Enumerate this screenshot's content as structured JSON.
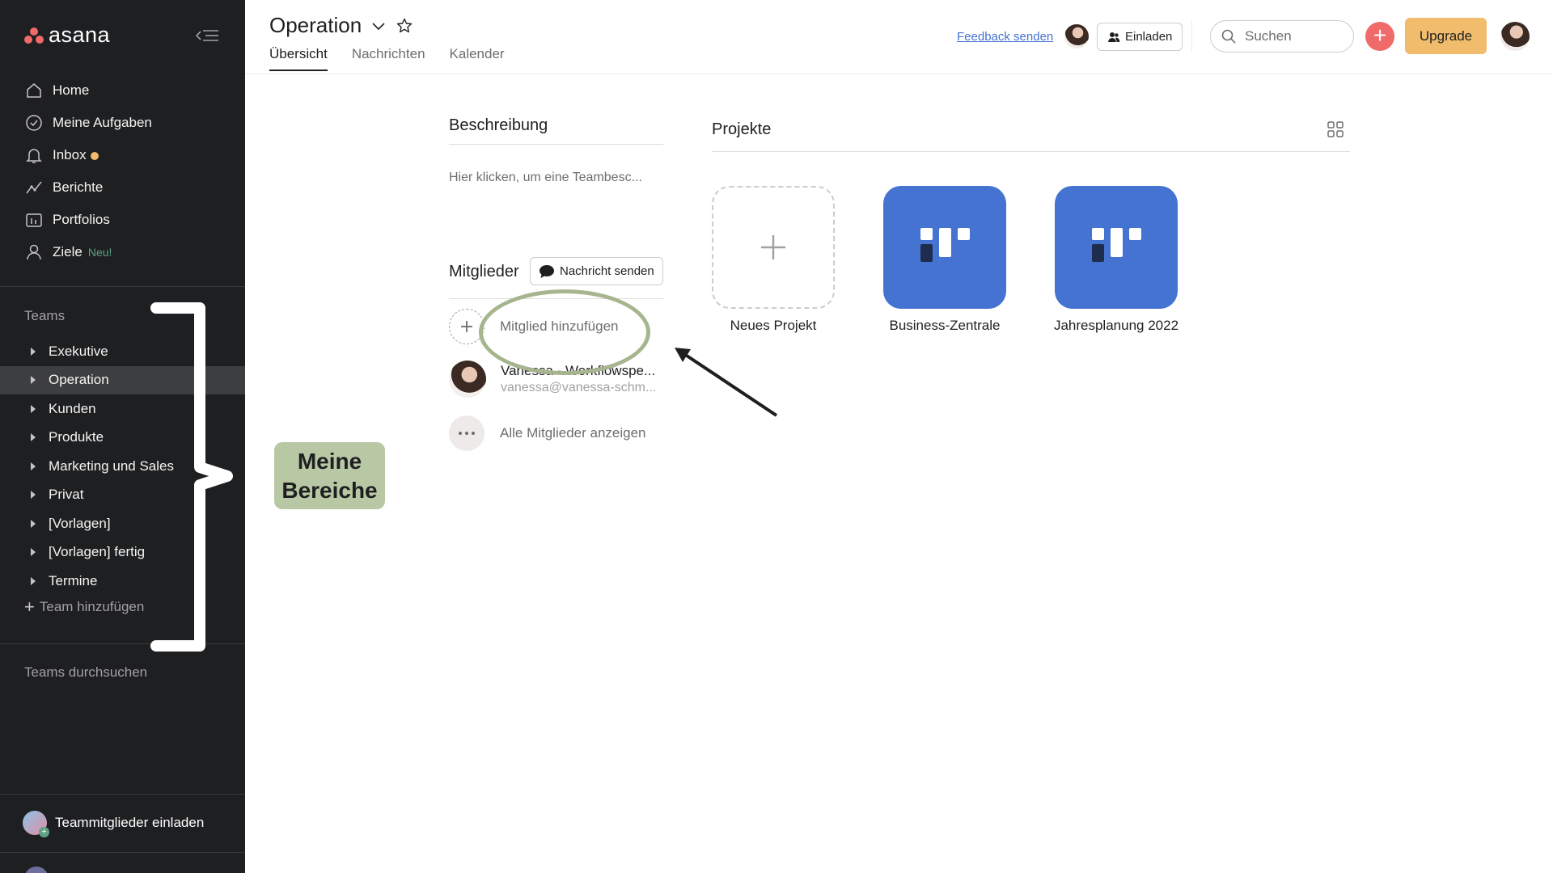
{
  "sidebar": {
    "logo_text": "asana",
    "nav": [
      {
        "label": "Home",
        "icon": "home-icon"
      },
      {
        "label": "Meine Aufgaben",
        "icon": "check-circle-icon"
      },
      {
        "label": "Inbox",
        "icon": "bell-icon"
      },
      {
        "label": "Berichte",
        "icon": "chart-line-icon"
      },
      {
        "label": "Portfolios",
        "icon": "portfolio-icon"
      },
      {
        "label": "Ziele",
        "icon": "person-goal-icon",
        "badge": "Neu!"
      }
    ],
    "teams_heading": "Teams",
    "teams": [
      "Exekutive",
      "Operation",
      "Kunden",
      "Produkte",
      "Marketing und Sales",
      "Privat",
      "[Vorlagen]",
      "[Vorlagen] fertig",
      "Termine"
    ],
    "active_team": "Operation",
    "add_team": "Team hinzufügen",
    "browse_teams": "Teams durchsuchen",
    "invite": "Teammitglieder einladen"
  },
  "annotation": {
    "callout_line1": "Meine",
    "callout_line2": "Bereiche"
  },
  "header": {
    "title": "Operation",
    "tabs": [
      "Übersicht",
      "Nachrichten",
      "Kalender"
    ],
    "active_tab": "Übersicht",
    "feedback": "Feedback senden",
    "invite": "Einladen",
    "search_placeholder": "Suchen",
    "upgrade": "Upgrade"
  },
  "main": {
    "description_title": "Beschreibung",
    "description_placeholder": "Hier klicken, um eine Teambesc...",
    "members_title": "Mitglieder",
    "send_message": "Nachricht senden",
    "add_member": "Mitglied hinzufügen",
    "member_name": "Vanessa - Workflowspe...",
    "member_email": "vanessa@vanessa-schm...",
    "show_all_members": "Alle Mitglieder anzeigen",
    "projects_title": "Projekte",
    "projects": [
      {
        "label": "Neues Projekt",
        "type": "new"
      },
      {
        "label": "Business-Zentrale",
        "type": "board"
      },
      {
        "label": "Jahresplanung 2022",
        "type": "board"
      }
    ]
  },
  "colors": {
    "sidebar_bg": "#1e1f21",
    "accent_red": "#f06a6a",
    "upgrade": "#f1bd6c",
    "project_blue": "#4573d2",
    "annotation_green": "#a7b58f"
  }
}
